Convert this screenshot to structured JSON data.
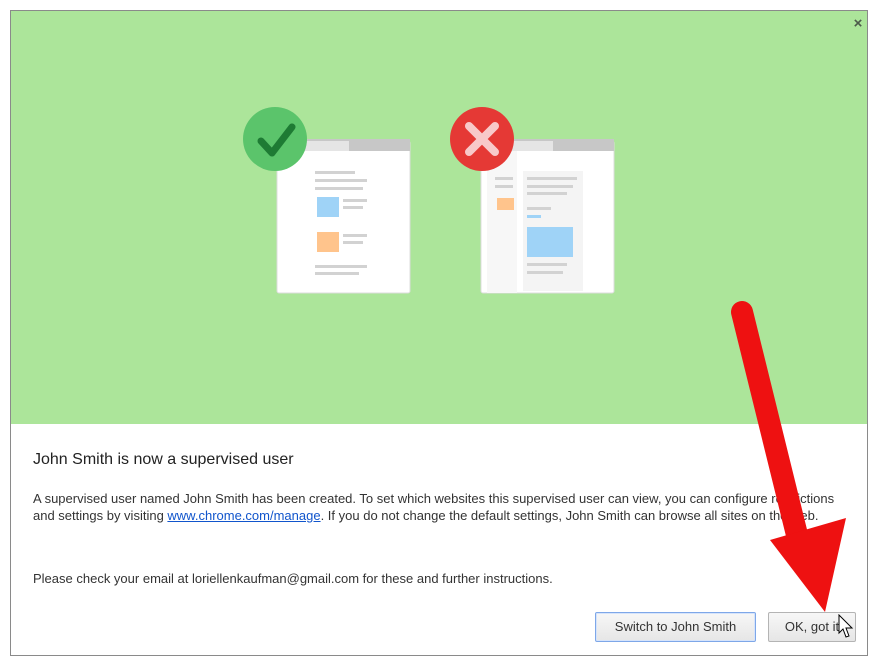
{
  "dialog": {
    "close_label": "×",
    "title": "John Smith is now a supervised user",
    "body_part1": "A supervised user named John Smith has been created. To set which websites this supervised user can view, you can configure restrictions and settings by visiting ",
    "link_text": "www.chrome.com/manage",
    "body_part2": ". If you do not change the default settings, John Smith can browse all sites on the web.",
    "email_text": "Please check your email at loriellenkaufman@gmail.com for these and further instructions.",
    "switch_button": "Switch to John Smith",
    "ok_button": "OK, got it"
  },
  "icons": {
    "allowed": "check-icon",
    "blocked": "x-icon",
    "annotation": "red-arrow",
    "pointer": "mouse-cursor-icon"
  },
  "colors": {
    "hero_bg": "#ace59a",
    "check_green": "#5bc46b",
    "x_red": "#e53935",
    "arrow_red": "#ee1111",
    "link": "#1155cc"
  }
}
